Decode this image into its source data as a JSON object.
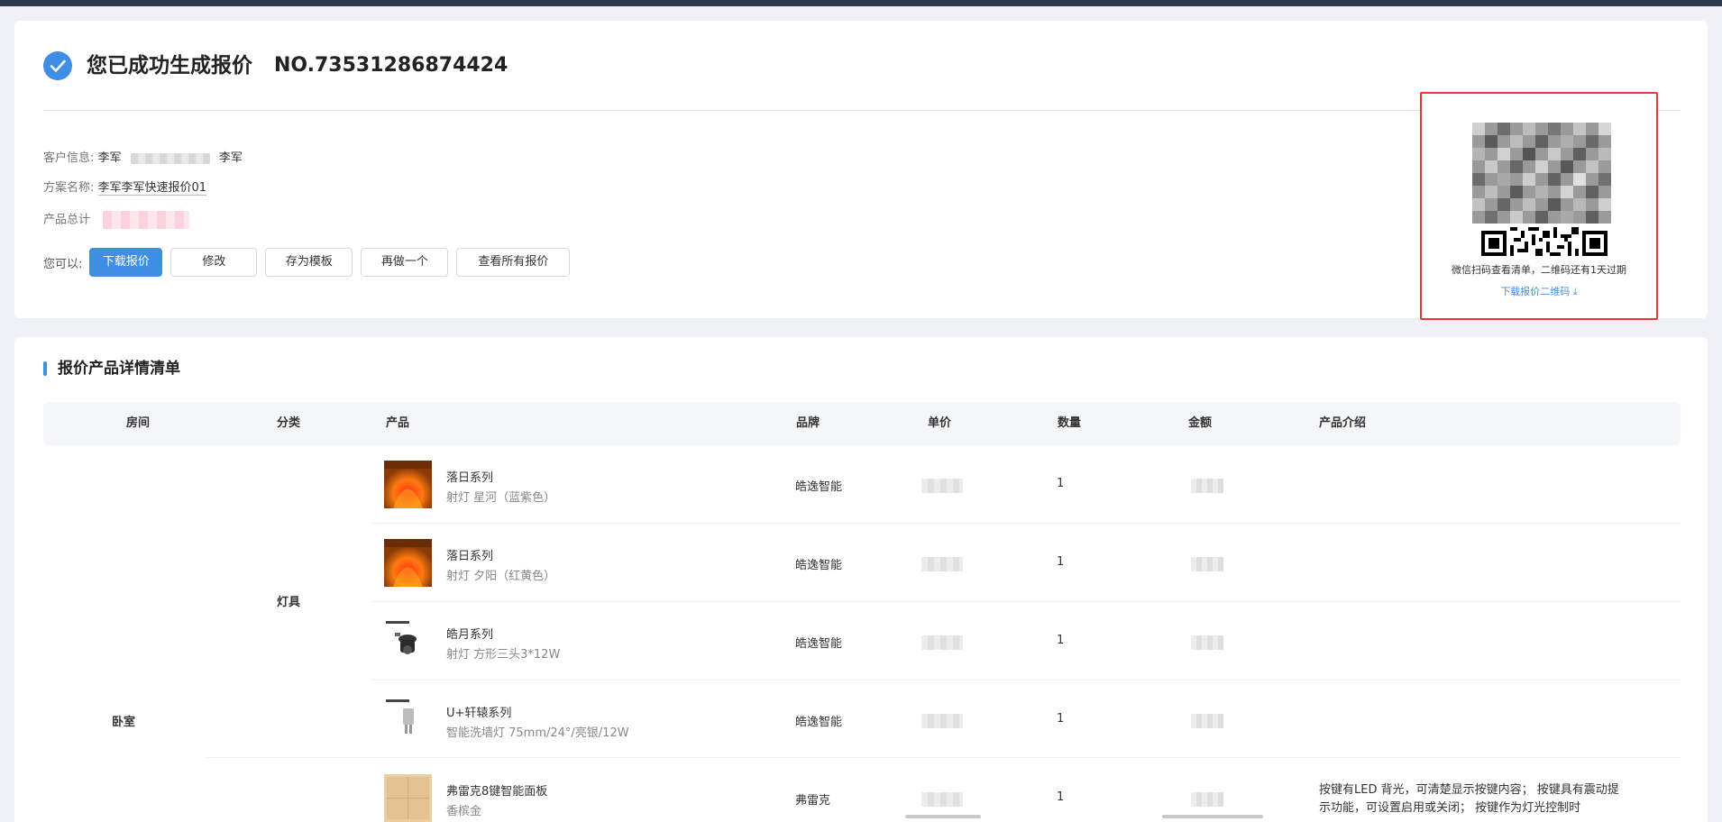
{
  "header": {
    "success_title": "您已成功生成报价",
    "order_no": "NO.73531286874424"
  },
  "info": {
    "customer_label": "客户信息:",
    "customer_name": "李军",
    "customer_name2": "李军",
    "plan_label": "方案名称:",
    "plan_name": "李军李军快速报价01",
    "total_label": "产品总计"
  },
  "actions": {
    "label": "您可以:",
    "download": "下载报价",
    "edit": "修改",
    "save_template": "存为模板",
    "redo": "再做一个",
    "view_all": "查看所有报价"
  },
  "qr": {
    "tip": "微信扫码查看清单，二维码还有1天过期",
    "download": "下载报价二维码 ⤓"
  },
  "detail": {
    "title": "报价产品详情清单",
    "columns": {
      "room": "房间",
      "category": "分类",
      "product": "产品",
      "brand": "品牌",
      "unit_price": "单价",
      "quantity": "数量",
      "amount": "金额",
      "intro": "产品介绍"
    },
    "room_value": "卧室",
    "category_value": "灯具",
    "rows": [
      {
        "name": "落日系列",
        "spec": "射灯 星河（蓝紫色）",
        "brand": "皓逸智能",
        "qty": "1",
        "intro": ""
      },
      {
        "name": "落日系列",
        "spec": "射灯 夕阳（红黄色）",
        "brand": "皓逸智能",
        "qty": "1",
        "intro": ""
      },
      {
        "name": "皓月系列",
        "spec": "射灯 方形三头3*12W",
        "brand": "皓逸智能",
        "qty": "1",
        "intro": ""
      },
      {
        "name": "U+轩辕系列",
        "spec": "智能洗墙灯 75mm/24°/亮银/12W",
        "brand": "皓逸智能",
        "qty": "1",
        "intro": ""
      },
      {
        "name": "弗雷克8键智能面板",
        "spec": "香槟金",
        "brand": "弗雷克",
        "qty": "1",
        "intro": "按键有LED 背光，可清楚显示按键内容； 按键具有震动提示功能，可设置启用或关闭； 按键作为灯光控制时"
      }
    ]
  },
  "colors": {
    "primary": "#3f8ee6",
    "highlight_border": "#e53935",
    "topbar": "#2e3a52"
  }
}
